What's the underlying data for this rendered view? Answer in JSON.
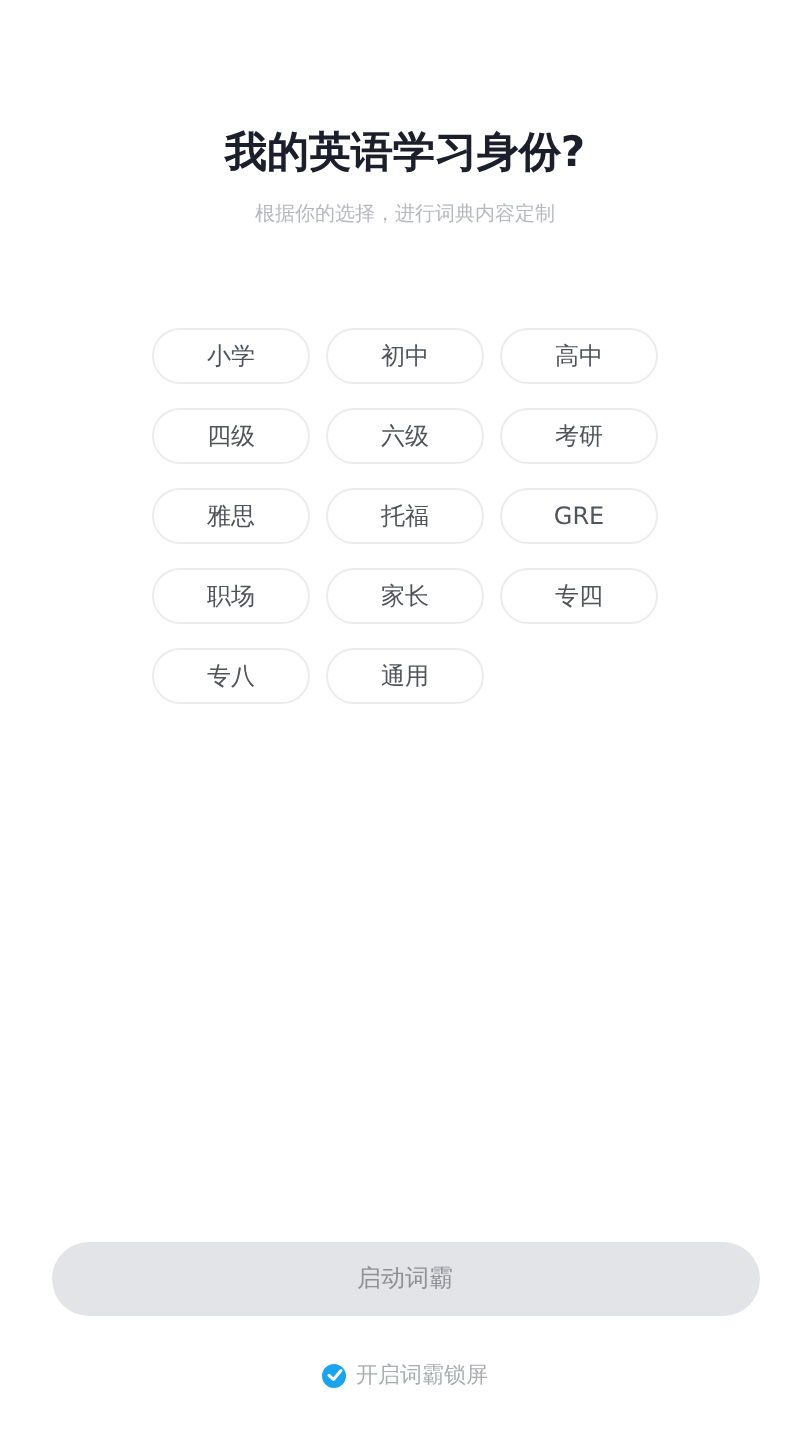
{
  "title": "我的英语学习身份?",
  "subtitle": "根据你的选择，进行词典内容定制",
  "options": [
    {
      "label": "小学",
      "selected": false
    },
    {
      "label": "初中",
      "selected": false
    },
    {
      "label": "高中",
      "selected": false
    },
    {
      "label": "四级",
      "selected": false
    },
    {
      "label": "六级",
      "selected": false
    },
    {
      "label": "考研",
      "selected": false
    },
    {
      "label": "雅思",
      "selected": false
    },
    {
      "label": "托福",
      "selected": false
    },
    {
      "label": "GRE",
      "selected": false
    },
    {
      "label": "职场",
      "selected": false
    },
    {
      "label": "家长",
      "selected": false
    },
    {
      "label": "专四",
      "selected": false
    },
    {
      "label": "专八",
      "selected": false
    },
    {
      "label": "通用",
      "selected": false
    }
  ],
  "start_button": {
    "label": "启动词霸",
    "disabled": true
  },
  "lock_screen": {
    "label": "开启词霸锁屏",
    "checked": true
  }
}
